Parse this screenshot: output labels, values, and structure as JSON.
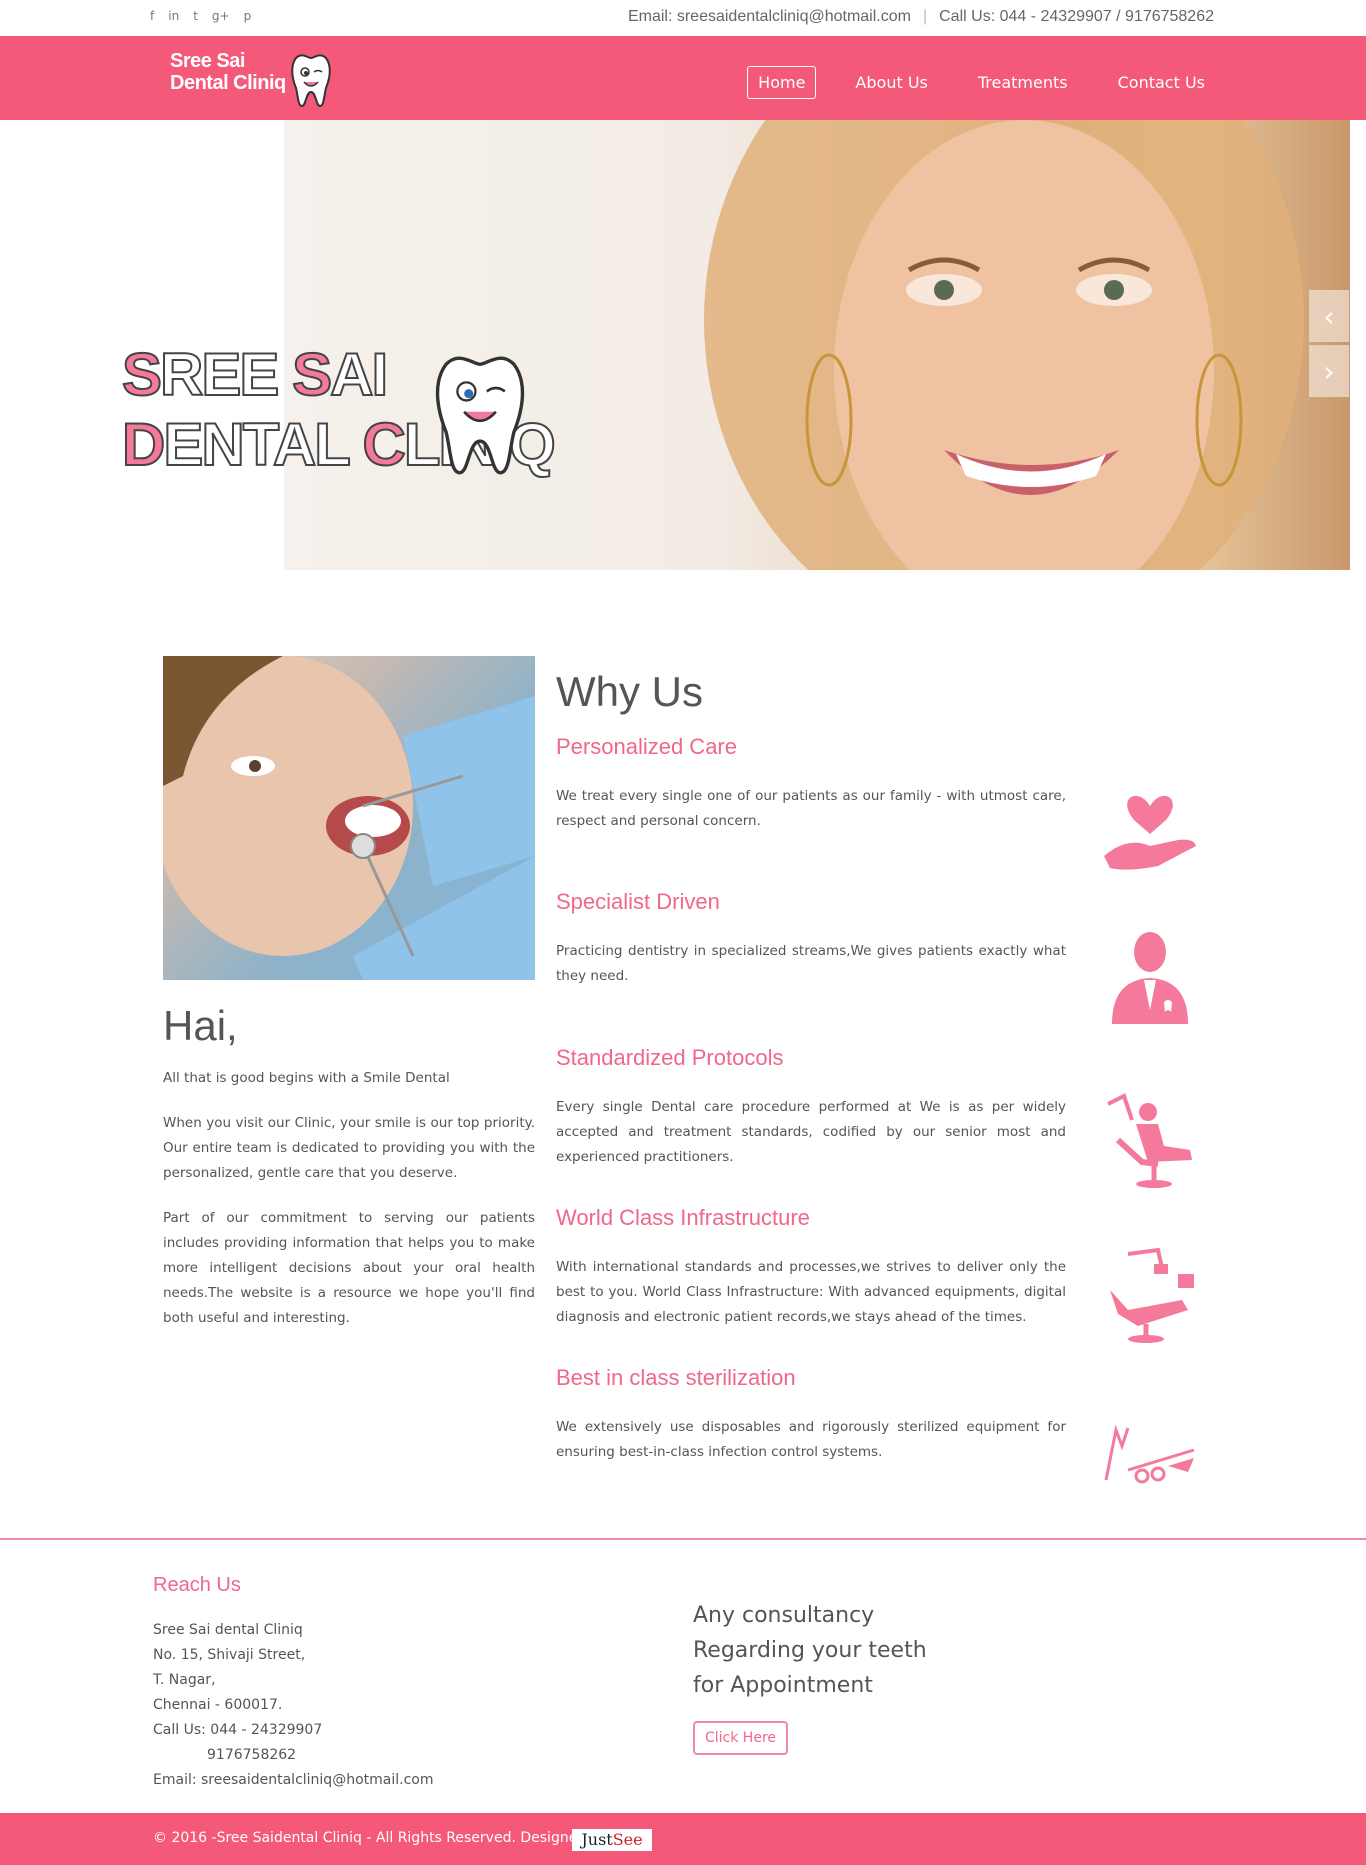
{
  "topbar": {
    "social": [
      "f",
      "in",
      "t",
      "g+",
      "p"
    ],
    "social_icons": [
      "facebook-icon",
      "linkedin-icon",
      "twitter-icon",
      "googleplus-icon",
      "pinterest-icon"
    ],
    "email": "Email: sreesaidentalcliniq@hotmail.com",
    "separator": "|",
    "phone": "Call Us: 044 - 24329907 / 9176758262"
  },
  "brand": {
    "line1": "Sree Sai",
    "line2": "Dental Cliniq",
    "accent": "#f4597a"
  },
  "nav": {
    "items": [
      "Home",
      "About Us",
      "Treatments",
      "Contact Us"
    ],
    "active": "Home"
  },
  "hero": {
    "line1_cap1": "S",
    "line1_rest1": "REE ",
    "line1_cap2": "S",
    "line1_rest2": "AI",
    "line2_cap1": "D",
    "line2_rest1": "ENTAL ",
    "line2_cap2": "C",
    "line2_rest2": "LINIQ",
    "prev": "‹",
    "next": "›"
  },
  "intro": {
    "greeting": "Hai,",
    "p1": "All that is good begins with a Smile Dental",
    "p2": "When you visit our Clinic, your smile is our top priority. Our entire team is dedicated to providing you with the personalized, gentle care that you deserve.",
    "p3": "Part of our commitment to serving our patients includes providing information that helps you to make more intelligent decisions about your oral health needs.The website is a resource we hope you'll find both useful and interesting."
  },
  "why": {
    "title": "Why Us",
    "features": [
      {
        "title": "Personalized Care",
        "text": "We treat every single one of our patients as our family - with utmost care, respect and personal concern.",
        "icon": "heart-hand-icon"
      },
      {
        "title": "Specialist Driven",
        "text": "Practicing dentistry in specialized streams,We gives patients exactly what they need.",
        "icon": "dentist-person-icon"
      },
      {
        "title": "Standardized Protocols",
        "text": "Every single Dental care procedure performed at We is as per widely accepted and treatment standards, codified by our senior most and experienced practitioners.",
        "icon": "dental-chair-patient-icon"
      },
      {
        "title": "World Class Infrastructure",
        "text": "With international standards and processes,we strives to deliver only the best to you. World Class Infrastructure: With advanced equipments, digital diagnosis and electronic patient records,we stays ahead of the times.",
        "icon": "dental-chair-icon"
      },
      {
        "title": "Best in class sterilization",
        "text": "We extensively use disposables and rigorously sterilized equipment for ensuring best-in-class infection control systems.",
        "icon": "dental-tools-icon"
      }
    ]
  },
  "footer": {
    "reach_title": "Reach Us",
    "address": [
      "Sree Sai dental Cliniq",
      "No. 15, Shivaji Street,",
      "T. Nagar,",
      "Chennai - 600017.",
      "Call Us: 044 - 24329907",
      "9176758262",
      "Email: sreesaidentalcliniq@hotmail.com"
    ],
    "consult_lines": [
      "Any consultancy",
      "Regarding your teeth",
      "for Appointment"
    ],
    "button": "Click Here",
    "copyright": "© 2016 -Sree Saidental Cliniq - All Rights Reserved. Designed by",
    "designer_a": "Just",
    "designer_b": "See"
  }
}
